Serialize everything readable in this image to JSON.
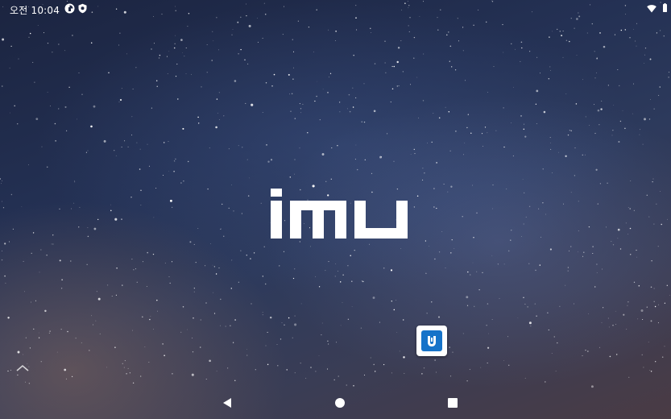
{
  "status_bar": {
    "time": "오전 10:04",
    "left_icons": [
      "data-saver-icon",
      "shield-icon"
    ],
    "right_icons": [
      "wifi-icon",
      "battery-icon"
    ]
  },
  "home": {
    "logo_text": "imu",
    "app_icon": "imu-app-icon",
    "edge_handle_icon": "chevron-up-icon"
  },
  "nav_bar": {
    "buttons": [
      "back-icon",
      "home-icon",
      "recents-icon"
    ]
  },
  "colors": {
    "app_icon_blue": "#1673c9",
    "status_text": "#ffffff"
  }
}
